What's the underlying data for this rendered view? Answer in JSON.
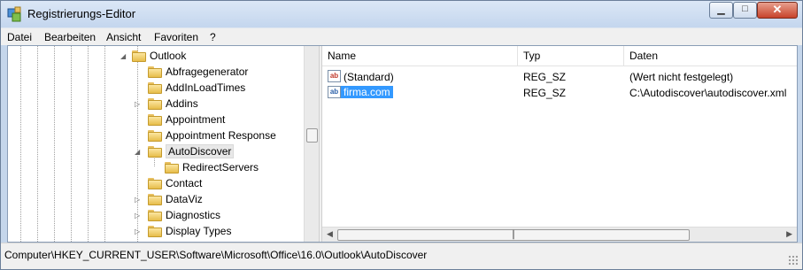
{
  "window": {
    "title": "Registrierungs-Editor"
  },
  "menu": [
    {
      "label": "Datei"
    },
    {
      "label": "Bearbeiten"
    },
    {
      "label": "Ansicht"
    },
    {
      "label": "Favoriten"
    },
    {
      "label": "?"
    }
  ],
  "tree": {
    "items": [
      {
        "label": "Outlook",
        "expander": "expanded"
      },
      {
        "label": "Abfragegenerator",
        "expander": "none"
      },
      {
        "label": "AddInLoadTimes",
        "expander": "none"
      },
      {
        "label": "Addins",
        "expander": "collapsed"
      },
      {
        "label": "Appointment",
        "expander": "none"
      },
      {
        "label": "Appointment Response",
        "expander": "none"
      },
      {
        "label": "AutoDiscover",
        "expander": "expanded",
        "selected": true
      },
      {
        "label": "RedirectServers",
        "expander": "none"
      },
      {
        "label": "Contact",
        "expander": "none"
      },
      {
        "label": "DataViz",
        "expander": "collapsed"
      },
      {
        "label": "Diagnostics",
        "expander": "collapsed"
      },
      {
        "label": "Display Types",
        "expander": "collapsed"
      }
    ]
  },
  "list": {
    "columns": {
      "name": "Name",
      "type": "Typ",
      "data": "Daten"
    },
    "rows": [
      {
        "name": "(Standard)",
        "type": "REG_SZ",
        "data": "(Wert nicht festgelegt)",
        "selected": false
      },
      {
        "name": "firma.com",
        "type": "REG_SZ",
        "data": "C:\\Autodiscover\\autodiscover.xml",
        "selected": true
      }
    ],
    "value_icon_text": "ab"
  },
  "status": {
    "path": "Computer\\HKEY_CURRENT_USER\\Software\\Microsoft\\Office\\16.0\\Outlook\\AutoDiscover"
  },
  "icons": {
    "app": "registry-editor-icon",
    "minimize": "minimize-icon",
    "maximize": "maximize-icon",
    "close": "close-icon",
    "folder": "folder-icon",
    "value": "string-value-icon"
  },
  "colors": {
    "selection": "#3399ff",
    "titlebar": "#c4d6ee",
    "close_button": "#c7432b"
  }
}
